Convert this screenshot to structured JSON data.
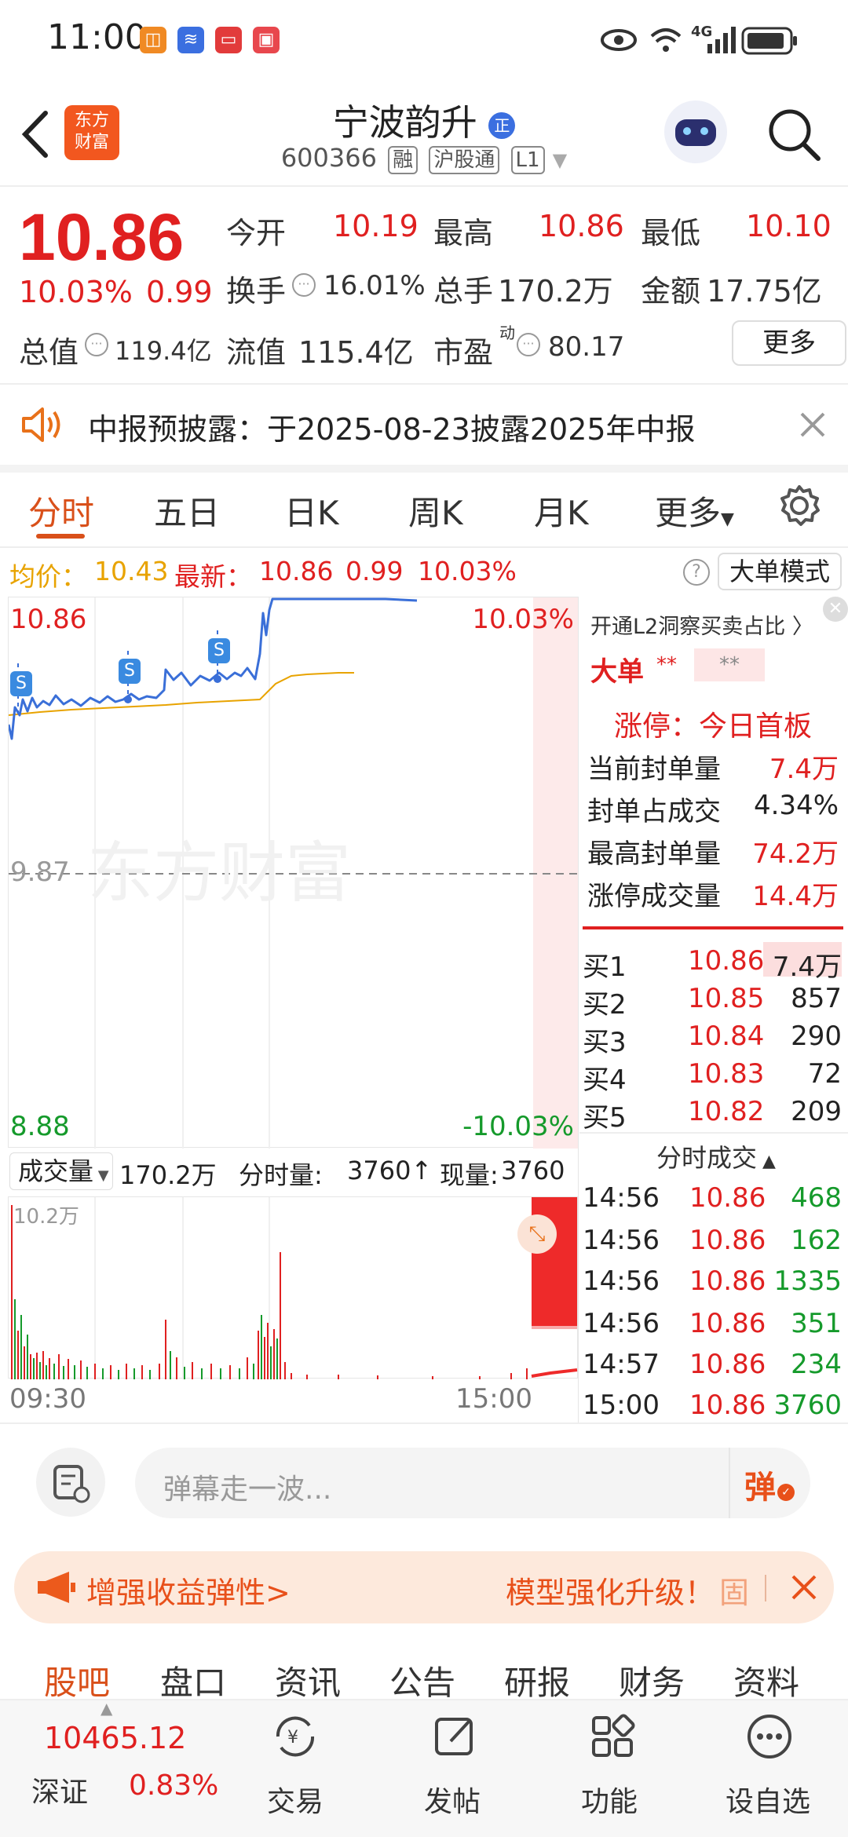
{
  "status_bar": {
    "time": "11:00",
    "signal": "4G"
  },
  "header": {
    "stock_name": "宁波韵升",
    "name_badge": "正",
    "stock_code": "600366",
    "tags": [
      "融",
      "沪股通",
      "L1"
    ],
    "logo_text": [
      "东方",
      "财富"
    ]
  },
  "quote": {
    "price": "10.86",
    "change_pct": "10.03%",
    "change_amt": "0.99",
    "open_label": "今开",
    "open": "10.19",
    "high_label": "最高",
    "high": "10.86",
    "low_label": "最低",
    "low": "10.10",
    "turnover_label": "换手",
    "turnover": "16.01%",
    "volume_label": "总手",
    "volume": "170.2万",
    "amount_label": "金额",
    "amount": "17.75亿",
    "mktcap_label": "总值",
    "mktcap": "119.4亿",
    "float_label": "流值",
    "float_cap": "115.4亿",
    "pe_label": "市盈",
    "pe_sup": "动",
    "pe": "80.17",
    "more_label": "更多"
  },
  "notice": {
    "text": "中报预披露：于2025-08-23披露2025年中报"
  },
  "tabs": [
    "分时",
    "五日",
    "日K",
    "周K",
    "月K",
    "更多"
  ],
  "avg_bar": {
    "avg_label": "均价：",
    "avg": "10.43",
    "latest_label": "最新：",
    "latest": "10.86",
    "chg": "0.99",
    "pct": "10.03%",
    "mode_label": "大单模式"
  },
  "chart_labels": {
    "top_price": "10.86",
    "top_pct": "10.03%",
    "mid_price": "9.87",
    "bottom_price": "8.88",
    "bottom_pct": "-10.03%",
    "watermark": "东方财富",
    "s_marker": "S",
    "vol_max": "10.2万",
    "time_start": "09:30",
    "time_end": "15:00"
  },
  "volume_row": {
    "selector": "成交量",
    "total": "170.2万",
    "minute_label": "分时量:",
    "minute": "3760",
    "now_label": "现量:",
    "now": "3760"
  },
  "right_panel": {
    "l2_link": "开通L2洞察买卖占比",
    "big_order": "大单",
    "big_a": "**",
    "big_b": "**",
    "limit_title": "涨停：今日首板",
    "limit_rows": [
      {
        "label": "当前封单量",
        "value": "7.4万"
      },
      {
        "label": "封单占成交",
        "value": "4.34%"
      },
      {
        "label": "最高封单量",
        "value": "74.2万"
      },
      {
        "label": "涨停成交量",
        "value": "14.4万"
      }
    ],
    "bids": [
      {
        "label": "买1",
        "price": "10.86",
        "vol": "7.4万"
      },
      {
        "label": "买2",
        "price": "10.85",
        "vol": "857"
      },
      {
        "label": "买3",
        "price": "10.84",
        "vol": "290"
      },
      {
        "label": "买4",
        "price": "10.83",
        "vol": "72"
      },
      {
        "label": "买5",
        "price": "10.82",
        "vol": "209"
      }
    ],
    "ticks_title": "分时成交",
    "ticks": [
      {
        "time": "14:56",
        "price": "10.86",
        "vol": "468"
      },
      {
        "time": "14:56",
        "price": "10.86",
        "vol": "162"
      },
      {
        "time": "14:56",
        "price": "10.86",
        "vol": "1335"
      },
      {
        "time": "14:56",
        "price": "10.86",
        "vol": "351"
      },
      {
        "time": "14:57",
        "price": "10.86",
        "vol": "234"
      },
      {
        "time": "15:00",
        "price": "10.86",
        "vol": "3760"
      }
    ]
  },
  "comment": {
    "placeholder": "弹幕走一波...",
    "danmu_btn": "弹"
  },
  "ad": {
    "left": "增强收益弹性>",
    "right": "模型强化升级！",
    "tail": "固"
  },
  "bottom_tabs": [
    "股吧",
    "盘口",
    "资讯",
    "公告",
    "研报",
    "财务",
    "资料"
  ],
  "nav": {
    "index_value": "10465.12",
    "index_name": "深证",
    "index_pct": "0.83%",
    "items": [
      "交易",
      "发帖",
      "功能",
      "设自选"
    ]
  },
  "colors": {
    "up": "#e02020",
    "down": "#159a2b",
    "accent": "#d9501a",
    "avg": "#e8a300"
  }
}
